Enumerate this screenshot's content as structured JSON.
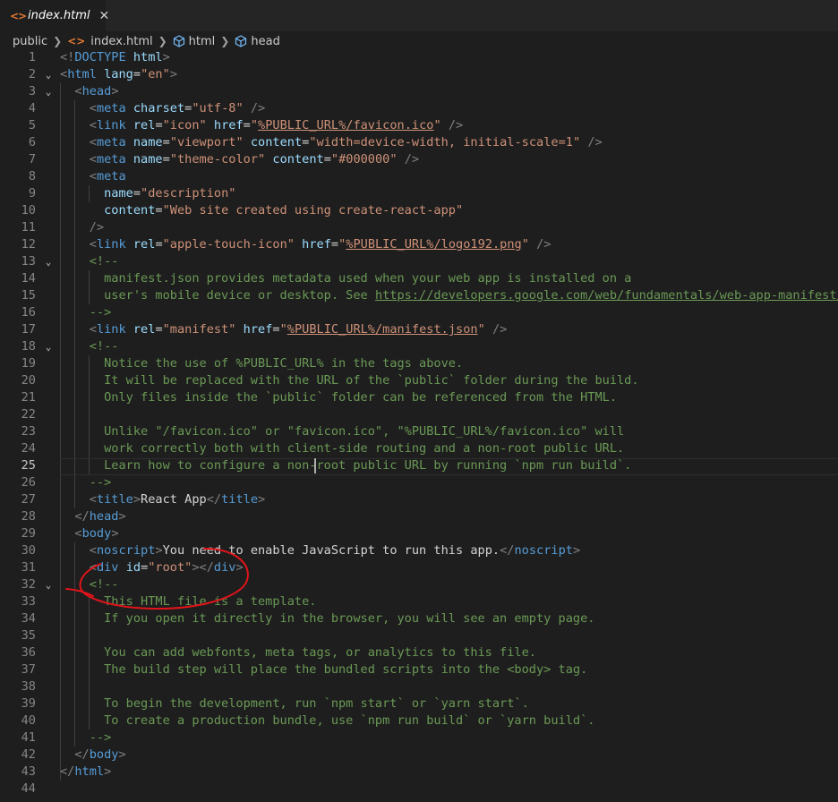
{
  "tab": {
    "icon": "html-file-icon",
    "label": "index.html",
    "close": "✕"
  },
  "breadcrumb": {
    "items": [
      "public",
      "index.html",
      "html",
      "head"
    ]
  },
  "editor": {
    "active_line": 25,
    "lines": [
      {
        "n": "1",
        "tokens": [
          [
            "t",
            "<!"
          ],
          [
            "n",
            "DOCTYPE"
          ],
          [
            "x",
            " "
          ],
          [
            "a",
            "html"
          ],
          [
            "t",
            ">"
          ]
        ]
      },
      {
        "n": "2",
        "tokens": [
          [
            "t",
            "<"
          ],
          [
            "n",
            "html"
          ],
          [
            "x",
            " "
          ],
          [
            "a",
            "lang"
          ],
          [
            "x",
            "="
          ],
          [
            "s",
            "\"en\""
          ],
          [
            "t",
            ">"
          ]
        ]
      },
      {
        "n": "3",
        "tokens": [
          [
            "x",
            "  "
          ],
          [
            "t",
            "<"
          ],
          [
            "n",
            "head"
          ],
          [
            "t",
            ">"
          ]
        ]
      },
      {
        "n": "4",
        "tokens": [
          [
            "x",
            "    "
          ],
          [
            "t",
            "<"
          ],
          [
            "n",
            "meta"
          ],
          [
            "x",
            " "
          ],
          [
            "a",
            "charset"
          ],
          [
            "x",
            "="
          ],
          [
            "s",
            "\"utf-8\""
          ],
          [
            "x",
            " "
          ],
          [
            "t",
            "/>"
          ]
        ]
      },
      {
        "n": "5",
        "tokens": [
          [
            "x",
            "    "
          ],
          [
            "t",
            "<"
          ],
          [
            "n",
            "link"
          ],
          [
            "x",
            " "
          ],
          [
            "a",
            "rel"
          ],
          [
            "x",
            "="
          ],
          [
            "s",
            "\"icon\""
          ],
          [
            "x",
            " "
          ],
          [
            "a",
            "href"
          ],
          [
            "x",
            "="
          ],
          [
            "s",
            "\""
          ],
          [
            "su",
            "%PUBLIC_URL%/favicon.ico"
          ],
          [
            "s",
            "\""
          ],
          [
            "x",
            " "
          ],
          [
            "t",
            "/>"
          ]
        ]
      },
      {
        "n": "6",
        "tokens": [
          [
            "x",
            "    "
          ],
          [
            "t",
            "<"
          ],
          [
            "n",
            "meta"
          ],
          [
            "x",
            " "
          ],
          [
            "a",
            "name"
          ],
          [
            "x",
            "="
          ],
          [
            "s",
            "\"viewport\""
          ],
          [
            "x",
            " "
          ],
          [
            "a",
            "content"
          ],
          [
            "x",
            "="
          ],
          [
            "s",
            "\"width=device-width, initial-scale=1\""
          ],
          [
            "x",
            " "
          ],
          [
            "t",
            "/>"
          ]
        ]
      },
      {
        "n": "7",
        "tokens": [
          [
            "x",
            "    "
          ],
          [
            "t",
            "<"
          ],
          [
            "n",
            "meta"
          ],
          [
            "x",
            " "
          ],
          [
            "a",
            "name"
          ],
          [
            "x",
            "="
          ],
          [
            "s",
            "\"theme-color\""
          ],
          [
            "x",
            " "
          ],
          [
            "a",
            "content"
          ],
          [
            "x",
            "="
          ],
          [
            "s",
            "\"#000000\""
          ],
          [
            "x",
            " "
          ],
          [
            "t",
            "/>"
          ]
        ]
      },
      {
        "n": "8",
        "tokens": [
          [
            "x",
            "    "
          ],
          [
            "t",
            "<"
          ],
          [
            "n",
            "meta"
          ]
        ]
      },
      {
        "n": "9",
        "tokens": [
          [
            "x",
            "      "
          ],
          [
            "a",
            "name"
          ],
          [
            "x",
            "="
          ],
          [
            "s",
            "\"description\""
          ]
        ]
      },
      {
        "n": "10",
        "tokens": [
          [
            "x",
            "      "
          ],
          [
            "a",
            "content"
          ],
          [
            "x",
            "="
          ],
          [
            "s",
            "\"Web site created using create-react-app\""
          ]
        ]
      },
      {
        "n": "11",
        "tokens": [
          [
            "x",
            "    "
          ],
          [
            "t",
            "/>"
          ]
        ]
      },
      {
        "n": "12",
        "tokens": [
          [
            "x",
            "    "
          ],
          [
            "t",
            "<"
          ],
          [
            "n",
            "link"
          ],
          [
            "x",
            " "
          ],
          [
            "a",
            "rel"
          ],
          [
            "x",
            "="
          ],
          [
            "s",
            "\"apple-touch-icon\""
          ],
          [
            "x",
            " "
          ],
          [
            "a",
            "href"
          ],
          [
            "x",
            "="
          ],
          [
            "s",
            "\""
          ],
          [
            "su",
            "%PUBLIC_URL%/logo192.png"
          ],
          [
            "s",
            "\""
          ],
          [
            "x",
            " "
          ],
          [
            "t",
            "/>"
          ]
        ]
      },
      {
        "n": "13",
        "tokens": [
          [
            "x",
            "    "
          ],
          [
            "c",
            "<!--"
          ]
        ]
      },
      {
        "n": "14",
        "tokens": [
          [
            "x",
            "      "
          ],
          [
            "c",
            "manifest.json provides metadata used when your web app is installed on a"
          ]
        ]
      },
      {
        "n": "15",
        "tokens": [
          [
            "x",
            "      "
          ],
          [
            "c",
            "user's mobile device or desktop. See "
          ],
          [
            "cu",
            "https://developers.google.com/web/fundamentals/web-app-manifest/"
          ]
        ]
      },
      {
        "n": "16",
        "tokens": [
          [
            "x",
            "    "
          ],
          [
            "c",
            "-->"
          ]
        ]
      },
      {
        "n": "17",
        "tokens": [
          [
            "x",
            "    "
          ],
          [
            "t",
            "<"
          ],
          [
            "n",
            "link"
          ],
          [
            "x",
            " "
          ],
          [
            "a",
            "rel"
          ],
          [
            "x",
            "="
          ],
          [
            "s",
            "\"manifest\""
          ],
          [
            "x",
            " "
          ],
          [
            "a",
            "href"
          ],
          [
            "x",
            "="
          ],
          [
            "s",
            "\""
          ],
          [
            "su",
            "%PUBLIC_URL%/manifest.json"
          ],
          [
            "s",
            "\""
          ],
          [
            "x",
            " "
          ],
          [
            "t",
            "/>"
          ]
        ]
      },
      {
        "n": "18",
        "tokens": [
          [
            "x",
            "    "
          ],
          [
            "c",
            "<!--"
          ]
        ]
      },
      {
        "n": "19",
        "tokens": [
          [
            "x",
            "      "
          ],
          [
            "c",
            "Notice the use of %PUBLIC_URL% in the tags above."
          ]
        ]
      },
      {
        "n": "20",
        "tokens": [
          [
            "x",
            "      "
          ],
          [
            "c",
            "It will be replaced with the URL of the `public` folder during the build."
          ]
        ]
      },
      {
        "n": "21",
        "tokens": [
          [
            "x",
            "      "
          ],
          [
            "c",
            "Only files inside the `public` folder can be referenced from the HTML."
          ]
        ]
      },
      {
        "n": "22",
        "tokens": []
      },
      {
        "n": "23",
        "tokens": [
          [
            "x",
            "      "
          ],
          [
            "c",
            "Unlike \"/favicon.ico\" or \"favicon.ico\", \"%PUBLIC_URL%/favicon.ico\" will"
          ]
        ]
      },
      {
        "n": "24",
        "tokens": [
          [
            "x",
            "      "
          ],
          [
            "c",
            "work correctly both with client-side routing and a non-root public URL."
          ]
        ]
      },
      {
        "n": "25",
        "tokens": [
          [
            "x",
            "      "
          ],
          [
            "c",
            "Learn how to configure a non-root public URL by running `npm run build`."
          ]
        ]
      },
      {
        "n": "26",
        "tokens": [
          [
            "x",
            "    "
          ],
          [
            "c",
            "-->"
          ]
        ]
      },
      {
        "n": "27",
        "tokens": [
          [
            "x",
            "    "
          ],
          [
            "t",
            "<"
          ],
          [
            "n",
            "title"
          ],
          [
            "t",
            ">"
          ],
          [
            "x",
            "React App"
          ],
          [
            "t",
            "</"
          ],
          [
            "n",
            "title"
          ],
          [
            "t",
            ">"
          ]
        ]
      },
      {
        "n": "28",
        "tokens": [
          [
            "x",
            "  "
          ],
          [
            "t",
            "</"
          ],
          [
            "n",
            "head"
          ],
          [
            "t",
            ">"
          ]
        ]
      },
      {
        "n": "29",
        "tokens": [
          [
            "x",
            "  "
          ],
          [
            "t",
            "<"
          ],
          [
            "n",
            "body"
          ],
          [
            "t",
            ">"
          ]
        ]
      },
      {
        "n": "30",
        "tokens": [
          [
            "x",
            "    "
          ],
          [
            "t",
            "<"
          ],
          [
            "n",
            "noscript"
          ],
          [
            "t",
            ">"
          ],
          [
            "x",
            "You need to enable JavaScript to run this app."
          ],
          [
            "t",
            "</"
          ],
          [
            "n",
            "noscript"
          ],
          [
            "t",
            ">"
          ]
        ]
      },
      {
        "n": "31",
        "tokens": [
          [
            "x",
            "    "
          ],
          [
            "t",
            "<"
          ],
          [
            "n",
            "div"
          ],
          [
            "x",
            " "
          ],
          [
            "a",
            "id"
          ],
          [
            "x",
            "="
          ],
          [
            "s",
            "\"root\""
          ],
          [
            "t",
            "></"
          ],
          [
            "n",
            "div"
          ],
          [
            "t",
            ">"
          ]
        ]
      },
      {
        "n": "32",
        "tokens": [
          [
            "x",
            "    "
          ],
          [
            "c",
            "<!--"
          ]
        ]
      },
      {
        "n": "33",
        "tokens": [
          [
            "x",
            "      "
          ],
          [
            "c",
            "This HTML file is a template."
          ]
        ]
      },
      {
        "n": "34",
        "tokens": [
          [
            "x",
            "      "
          ],
          [
            "c",
            "If you open it directly in the browser, you will see an empty page."
          ]
        ]
      },
      {
        "n": "35",
        "tokens": []
      },
      {
        "n": "36",
        "tokens": [
          [
            "x",
            "      "
          ],
          [
            "c",
            "You can add webfonts, meta tags, or analytics to this file."
          ]
        ]
      },
      {
        "n": "37",
        "tokens": [
          [
            "x",
            "      "
          ],
          [
            "c",
            "The build step will place the bundled scripts into the <body> tag."
          ]
        ]
      },
      {
        "n": "38",
        "tokens": []
      },
      {
        "n": "39",
        "tokens": [
          [
            "x",
            "      "
          ],
          [
            "c",
            "To begin the development, run `npm start` or `yarn start`."
          ]
        ]
      },
      {
        "n": "40",
        "tokens": [
          [
            "x",
            "      "
          ],
          [
            "c",
            "To create a production bundle, use `npm run build` or `yarn build`."
          ]
        ]
      },
      {
        "n": "41",
        "tokens": [
          [
            "x",
            "    "
          ],
          [
            "c",
            "-->"
          ]
        ]
      },
      {
        "n": "42",
        "tokens": [
          [
            "x",
            "  "
          ],
          [
            "t",
            "</"
          ],
          [
            "n",
            "body"
          ],
          [
            "t",
            ">"
          ]
        ]
      },
      {
        "n": "43",
        "tokens": [
          [
            "t",
            "</"
          ],
          [
            "n",
            "html"
          ],
          [
            "t",
            ">"
          ]
        ]
      },
      {
        "n": "44",
        "tokens": []
      }
    ],
    "fold_lines": [
      2,
      3,
      13,
      18,
      32
    ]
  },
  "colors": {
    "background": "#1e1e1e",
    "tag_bracket": "#808080",
    "tag_name": "#569cd6",
    "attribute": "#9cdcfe",
    "string": "#ce9178",
    "comment": "#6a9955",
    "annotation_circle": "#e0141a"
  }
}
